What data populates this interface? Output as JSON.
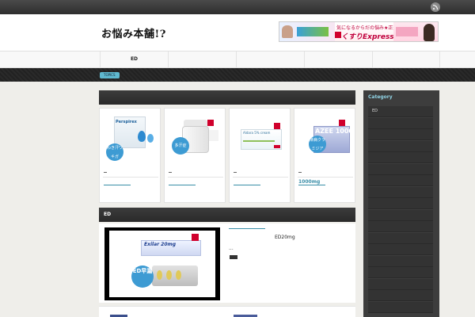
{
  "site": {
    "logo_text": "お悩み本舗!?"
  },
  "banner": {
    "line1": "気になるからだの悩み★正規医薬品で解決!",
    "brand": "くすりExpress"
  },
  "nav": {
    "items": [
      {
        "label": "ED"
      },
      {
        "label": ""
      },
      {
        "label": ""
      },
      {
        "label": ""
      },
      {
        "label": ""
      }
    ]
  },
  "ticker": {
    "badge": "TOPICS"
  },
  "featured": {
    "cards": [
      {
        "product": "Perspirex",
        "badge": "わき汗ワキガ",
        "link": ""
      },
      {
        "product": "",
        "badge": "多汗症",
        "link": ""
      },
      {
        "product": "Aldara 5% cream",
        "badge": "",
        "link": ""
      },
      {
        "product": "AZEE 1000",
        "badge": "淋病クラミジア",
        "link": "1000mg"
      }
    ]
  },
  "ed_section": {
    "title": "ED",
    "product": "Exilar 20mg",
    "badge": "ED早漏",
    "dosage": "ED20mg",
    "ellipsis": "..."
  },
  "sidebar": {
    "title": "Category",
    "items": [
      {
        "label": "ED"
      },
      {
        "label": ""
      },
      {
        "label": ""
      },
      {
        "label": ""
      },
      {
        "label": ""
      },
      {
        "label": ""
      },
      {
        "label": ""
      },
      {
        "label": ""
      },
      {
        "label": ""
      },
      {
        "label": ""
      },
      {
        "label": ""
      },
      {
        "label": ""
      },
      {
        "label": ""
      },
      {
        "label": ""
      },
      {
        "label": ""
      },
      {
        "label": ""
      },
      {
        "label": ""
      },
      {
        "label": ""
      }
    ]
  },
  "colors": {
    "accent": "#5fb8cf",
    "link": "#3a8ea8",
    "sidebar_bg": "#3d3d3d",
    "header_bar": "#2e2e2e"
  }
}
